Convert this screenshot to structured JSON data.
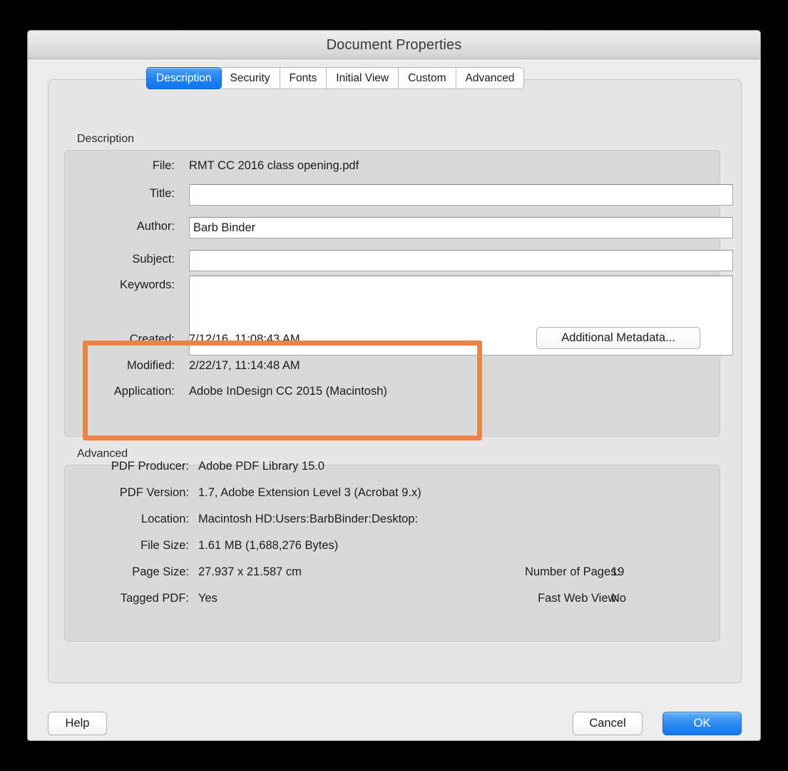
{
  "window": {
    "title": "Document Properties"
  },
  "tabs": [
    {
      "label": "Description",
      "active": true
    },
    {
      "label": "Security",
      "active": false
    },
    {
      "label": "Fonts",
      "active": false
    },
    {
      "label": "Initial View",
      "active": false
    },
    {
      "label": "Custom",
      "active": false
    },
    {
      "label": "Advanced",
      "active": false
    }
  ],
  "description": {
    "group_label": "Description",
    "file": {
      "label": "File:",
      "value": "RMT CC 2016 class opening.pdf"
    },
    "title": {
      "label": "Title:",
      "value": "",
      "placeholder": ""
    },
    "author": {
      "label": "Author:",
      "value": "Barb Binder",
      "placeholder": ""
    },
    "subject": {
      "label": "Subject:",
      "value": "",
      "placeholder": ""
    },
    "keywords": {
      "label": "Keywords:",
      "value": "",
      "placeholder": ""
    },
    "created": {
      "label": "Created:",
      "value": "7/12/16, 11:08:43 AM"
    },
    "modified": {
      "label": "Modified:",
      "value": "2/22/17, 11:14:48 AM"
    },
    "application": {
      "label": "Application:",
      "value": "Adobe InDesign CC 2015 (Macintosh)"
    },
    "additional_metadata_button": "Additional Metadata..."
  },
  "advanced": {
    "group_label": "Advanced",
    "rows_left": [
      {
        "label": "PDF Producer:",
        "value": "Adobe PDF Library 15.0"
      },
      {
        "label": "PDF Version:",
        "value": "1.7, Adobe Extension Level 3 (Acrobat 9.x)"
      },
      {
        "label": "Location:",
        "value": "Macintosh HD:Users:BarbBinder:Desktop:"
      },
      {
        "label": "File Size:",
        "value": "1.61 MB (1,688,276 Bytes)"
      },
      {
        "label": "Page Size:",
        "value": "27.937 x 21.587 cm"
      },
      {
        "label": "Tagged PDF:",
        "value": "Yes"
      }
    ],
    "rows_right": [
      {
        "label": "Number of Pages:",
        "value": "19"
      },
      {
        "label": "Fast Web View:",
        "value": "No"
      }
    ]
  },
  "footer": {
    "help": "Help",
    "cancel": "Cancel",
    "ok": "OK"
  },
  "annotation": {
    "highlight_color": "#ef8048",
    "highlight_target": "created-modified-application-block"
  },
  "colors": {
    "accent": "#1279ef",
    "dialog_bg": "#ececec",
    "panel_bg": "#e6e6e6",
    "group_bg": "#d9d9d9",
    "highlight": "#ef8048"
  }
}
